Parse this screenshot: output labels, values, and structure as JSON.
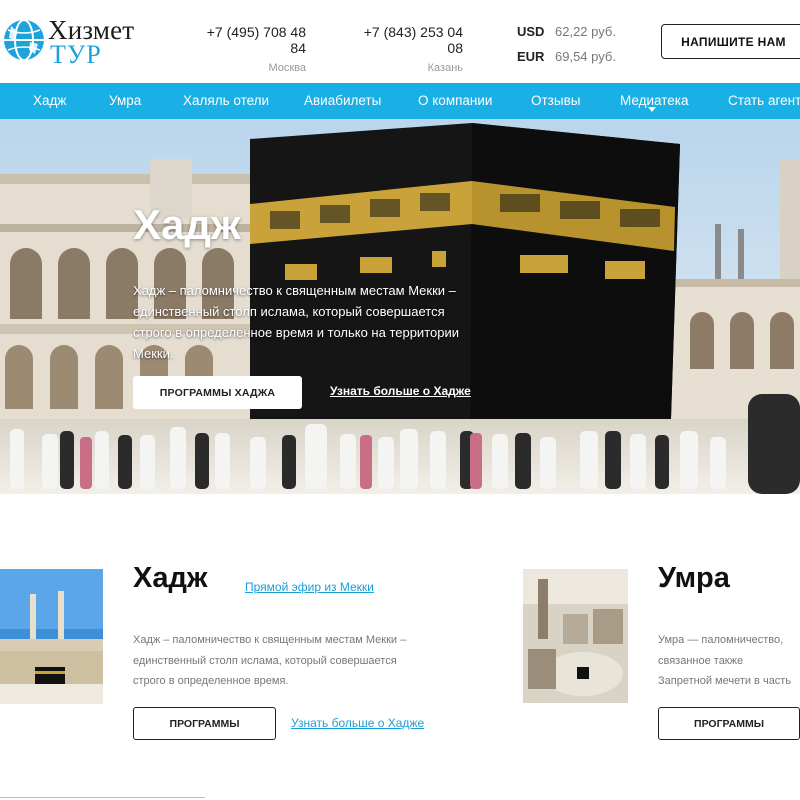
{
  "header": {
    "logo_title": "Хизмет",
    "logo_sub": "ТУР",
    "phones": [
      {
        "number": "+7 (495) 708 48 84",
        "city": "Москва"
      },
      {
        "number": "+7 (843) 253 04 08",
        "city": "Казань"
      }
    ],
    "rates": [
      {
        "code": "USD",
        "value": "62,22 руб."
      },
      {
        "code": "EUR",
        "value": "69,54 руб."
      }
    ],
    "write_button": "НАПИШИТЕ НАМ"
  },
  "nav": {
    "items": [
      "Хадж",
      "Умра",
      "Халяль отели",
      "Авиабилеты",
      "О компании",
      "Отзывы",
      "Медиатека",
      "Стать агентом"
    ]
  },
  "hero": {
    "title": "Хадж",
    "text": "Хадж – паломничество к священным местам Мекки – единственный столп ислама, который совершается строго в определенное время и только на территории Мекки.",
    "button": "ПРОГРАММЫ ХАДЖА",
    "link": "Узнать больше о Хадже"
  },
  "cards": [
    {
      "title": "Хадж",
      "live_link": "Прямой эфир из Мекки",
      "text": "Хадж – паломничество к священным местам Мекки – единственный столп ислама, который совершается строго в определенное время.",
      "button": "ПРОГРАММЫ",
      "more_link": "Узнать больше о Хадже"
    },
    {
      "title": "Умра",
      "text": "Умра — паломничество, связанное также Запретной мечети в часть предназначенный для Хаджа.",
      "button": "ПРОГРАММЫ"
    }
  ],
  "colors": {
    "accent": "#1ab0e6",
    "link": "#1a9fd9",
    "kaaba": "#151515",
    "gold": "#c9a23a"
  },
  "icons": {
    "logo": "globe-logo-icon",
    "dropdown": "chevron-down-icon"
  }
}
